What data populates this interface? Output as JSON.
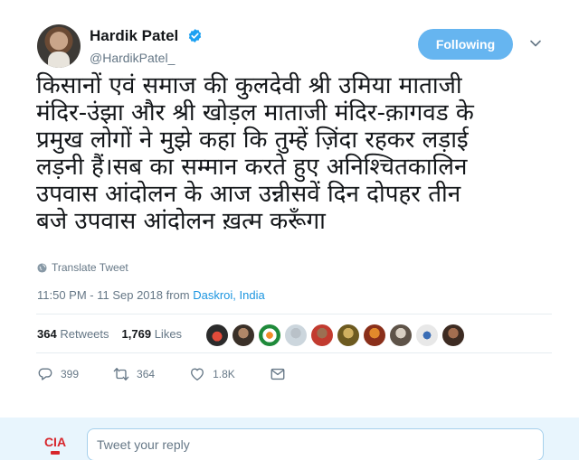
{
  "author": {
    "name": "Hardik Patel",
    "handle": "@HardikPatel_",
    "verified": true
  },
  "follow_button": {
    "label": "Following",
    "color": "#66b5f0"
  },
  "tweet": {
    "lines": [
      "किसानों एवं समाज की कुलदेवी श्री उमिया माताजी",
      "मंदिर-उंझा और श्री खोड़ल माताजी मंदिर-क़ागवड के",
      "प्रमुख लोगों ने मुझे कहा कि तुम्हें ज़िंदा रहकर लड़ाई",
      "लड़नी हैं।सब का सम्मान करते हुए अनिश्चितकालिन",
      "उपवास आंदोलन के आज उन्नीसवें दिन दोपहर तीन",
      "बजे उपवास आंदोलन ख़त्म करूँगा"
    ]
  },
  "translate": {
    "label": "Translate Tweet",
    "icon": "globe-icon"
  },
  "timestamp": {
    "time": "11:50 PM - 11 Sep 2018 from ",
    "location": "Daskroi, India"
  },
  "stats": {
    "retweets_count": "364",
    "retweets_label": "Retweets",
    "likes_count": "1,769",
    "likes_label": "Likes"
  },
  "actions": {
    "reply_count": "399",
    "retweet_count": "364",
    "like_count": "1.8K"
  },
  "reply": {
    "placeholder": "Tweet your reply",
    "avatar_text": "CIA"
  },
  "colors": {
    "link": "#1b95e0",
    "muted": "#657786",
    "reply_bar": "#e8f5fd",
    "verified": "#1da1f2"
  }
}
